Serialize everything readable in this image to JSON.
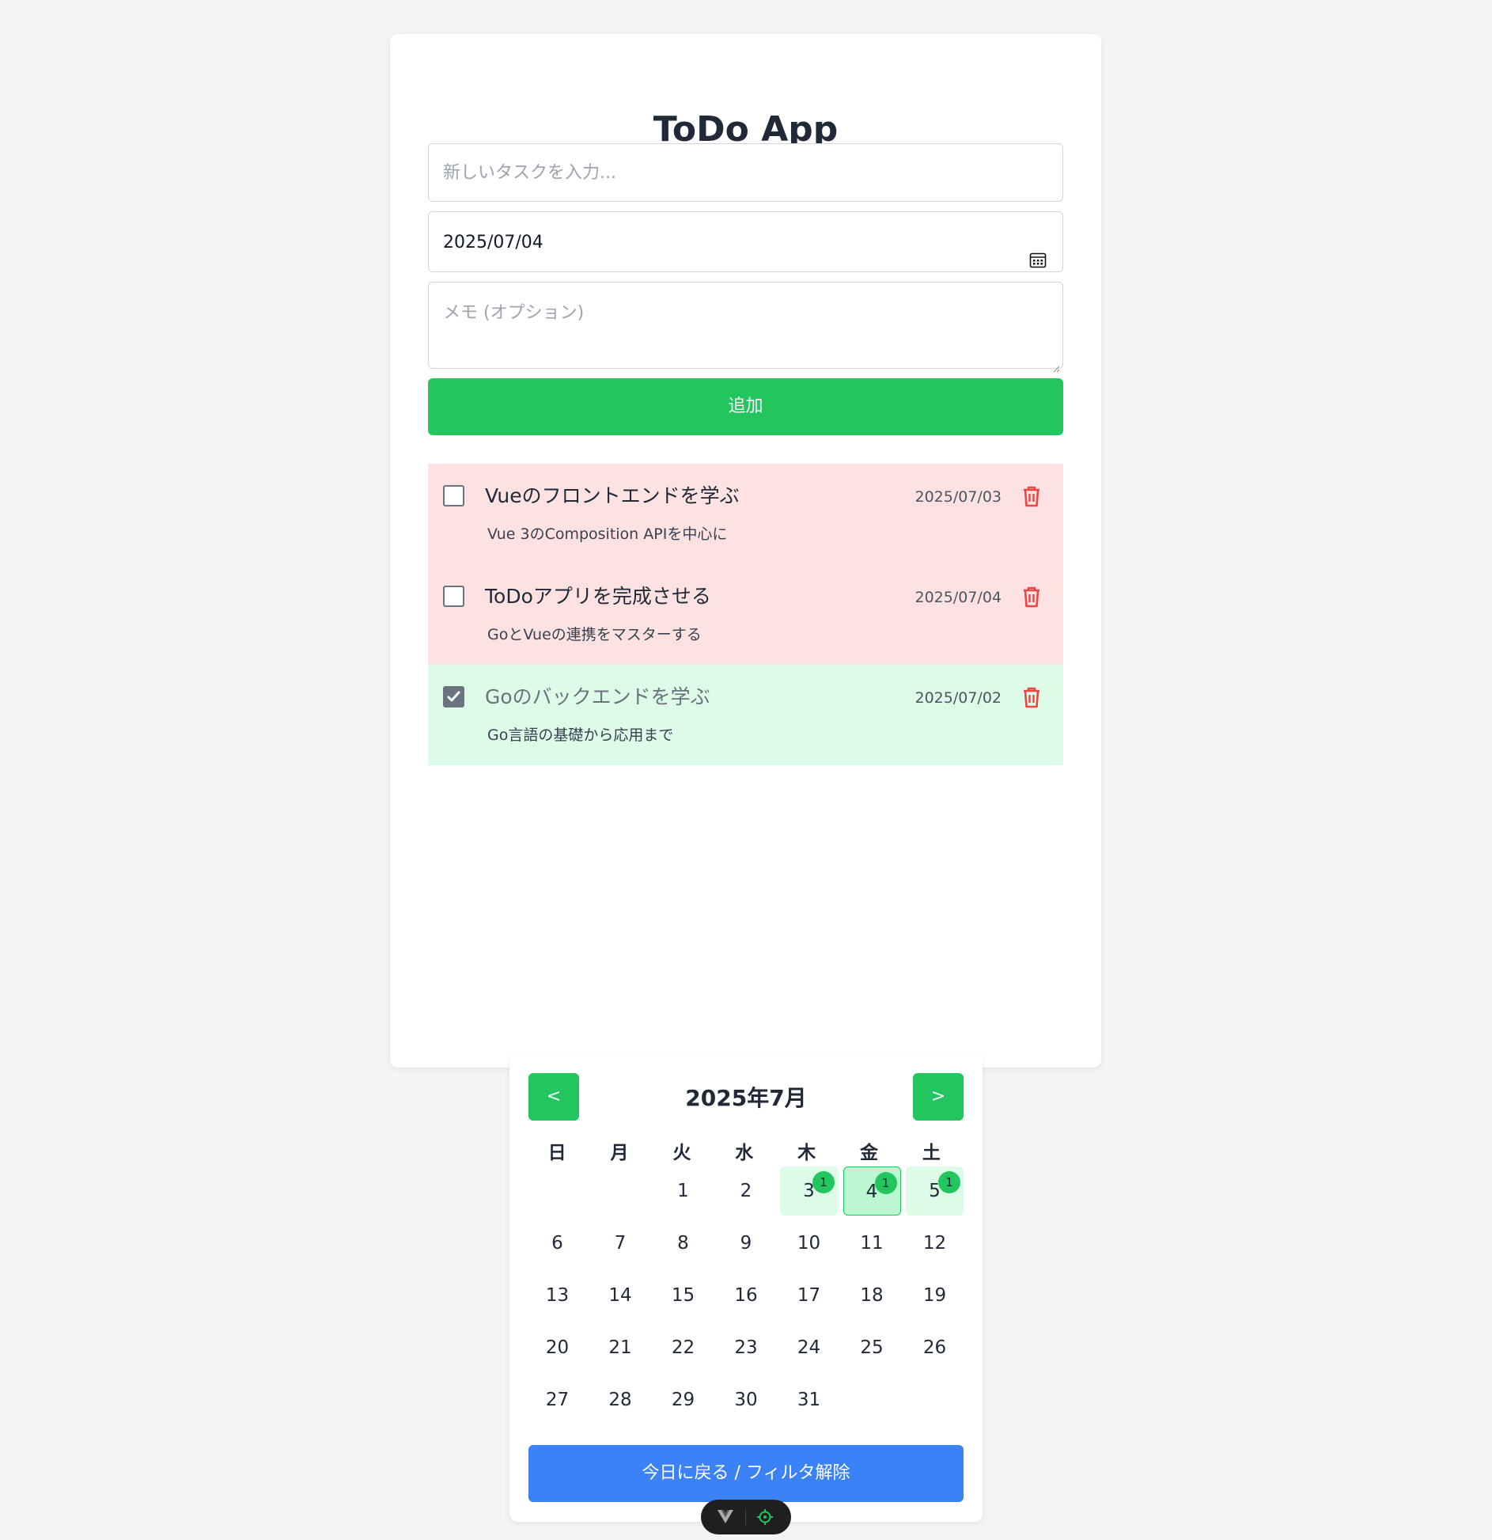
{
  "app": {
    "title": "ToDo App"
  },
  "form": {
    "task_placeholder": "新しいタスクを入力...",
    "date_value": "2025/07/04",
    "memo_placeholder": "メモ (オプション)",
    "add_label": "追加"
  },
  "todos": [
    {
      "title": "Vueのフロントエンドを学ぶ",
      "memo": "Vue 3のComposition APIを中心に",
      "date": "2025/07/03",
      "done": false
    },
    {
      "title": "ToDoアプリを完成させる",
      "memo": "GoとVueの連携をマスターする",
      "date": "2025/07/04",
      "done": false
    },
    {
      "title": "Goのバックエンドを学ぶ",
      "memo": "Go言語の基礎から応用まで",
      "date": "2025/07/02",
      "done": true
    }
  ],
  "calendar": {
    "month_label": "2025年7月",
    "prev_label": "<",
    "next_label": ">",
    "weekdays": [
      "日",
      "月",
      "火",
      "水",
      "木",
      "金",
      "土"
    ],
    "leading_blanks": 2,
    "days_in_month": 31,
    "marked_days": [
      {
        "day": 3,
        "count": "1"
      },
      {
        "day": 4,
        "count": "1",
        "selected": true
      },
      {
        "day": 5,
        "count": "1"
      }
    ],
    "reset_label": "今日に戻る / フィルタ解除"
  },
  "colors": {
    "accent_green": "#22c55e",
    "accent_blue": "#3b82f6",
    "pending_bg": "#fee2e2",
    "done_bg": "#dcfce7",
    "delete_red": "#ef4444"
  },
  "icons": {
    "date_field": "calendar-icon",
    "delete": "trash-icon",
    "devtools": "vue-logo-icon",
    "inspect": "crosshair-icon"
  }
}
